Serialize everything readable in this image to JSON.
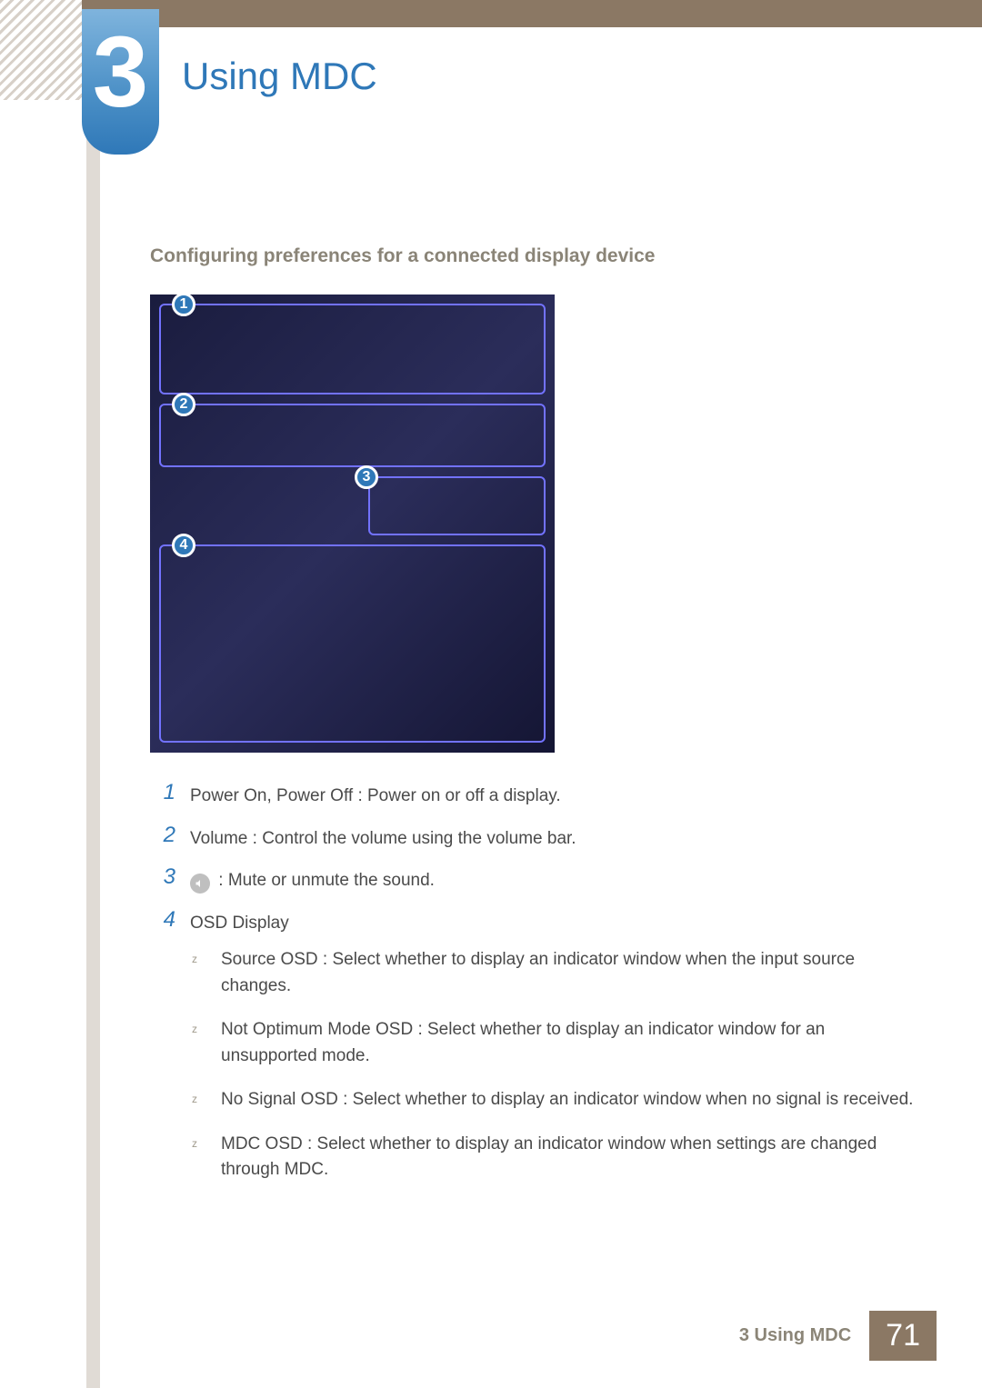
{
  "chapter": {
    "number": "3",
    "title": "Using MDC"
  },
  "section_title": "Configuring preferences for a connected display device",
  "callouts": {
    "c1": "1",
    "c2": "2",
    "c3": "3",
    "c4": "4"
  },
  "items": [
    {
      "num": "1",
      "text": "Power On, Power Off : Power on or off a display."
    },
    {
      "num": "2",
      "text": "Volume : Control the volume using the volume bar."
    },
    {
      "num": "3",
      "text": ": Mute or unmute the sound.",
      "has_speaker_icon": true
    },
    {
      "num": "4",
      "text": "OSD Display"
    }
  ],
  "sub_items": [
    "Source OSD : Select whether to display an indicator window when the input source changes.",
    "Not Optimum Mode OSD : Select whether to display an indicator window for an unsupported mode.",
    "No Signal OSD : Select whether to display an indicator window when no signal is received.",
    "MDC OSD : Select whether to display an indicator window when settings are changed through MDC."
  ],
  "footer": {
    "label": "3 Using MDC",
    "page": "71"
  }
}
